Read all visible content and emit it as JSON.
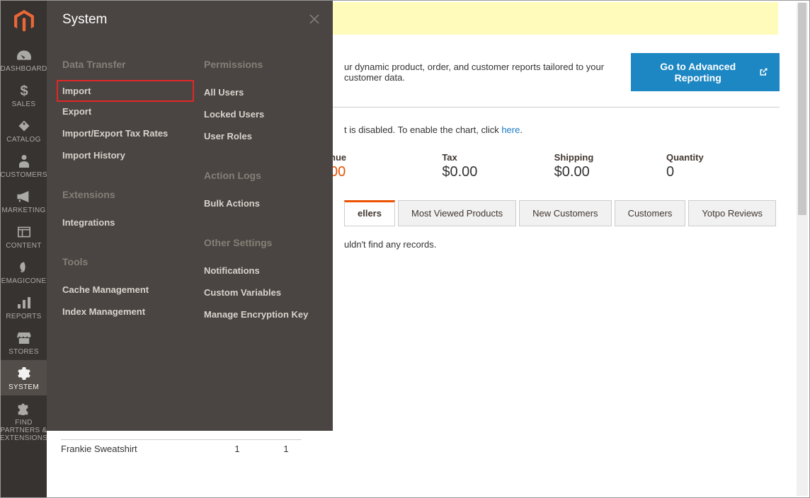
{
  "sidebar": {
    "items": [
      {
        "label": "DASHBOARD"
      },
      {
        "label": "SALES"
      },
      {
        "label": "CATALOG"
      },
      {
        "label": "CUSTOMERS"
      },
      {
        "label": "MARKETING"
      },
      {
        "label": "CONTENT"
      },
      {
        "label": "EMAGICONE"
      },
      {
        "label": "REPORTS"
      },
      {
        "label": "STORES"
      },
      {
        "label": "SYSTEM"
      },
      {
        "label": "FIND PARTNERS & EXTENSIONS"
      }
    ]
  },
  "flyout": {
    "title": "System",
    "groups": {
      "data_transfer": {
        "title": "Data Transfer",
        "import": "Import",
        "export": "Export",
        "tax_rates": "Import/Export Tax Rates",
        "history": "Import History"
      },
      "extensions": {
        "title": "Extensions",
        "integrations": "Integrations"
      },
      "tools": {
        "title": "Tools",
        "cache": "Cache Management",
        "index": "Index Management"
      },
      "permissions": {
        "title": "Permissions",
        "all_users": "All Users",
        "locked_users": "Locked Users",
        "user_roles": "User Roles"
      },
      "action_logs": {
        "title": "Action Logs",
        "bulk": "Bulk Actions"
      },
      "other_settings": {
        "title": "Other Settings",
        "notifications": "Notifications",
        "custom_vars": "Custom Variables",
        "encryption": "Manage Encryption Key"
      }
    }
  },
  "main": {
    "adv_rep_desc": "ur dynamic product, order, and customer reports tailored to your customer data.",
    "adv_rep_btn": "Go to Advanced Reporting",
    "chart_note_pre": "t is disabled. To enable the chart, click ",
    "chart_note_link": "here",
    "stats": {
      "revenue": {
        "label": "nue",
        "value": "00"
      },
      "tax": {
        "label": "Tax",
        "value": "$0.00"
      },
      "shipping": {
        "label": "Shipping",
        "value": "$0.00"
      },
      "quantity": {
        "label": "Quantity",
        "value": "0"
      }
    },
    "tabs": {
      "bestsellers": "ellers",
      "most_viewed": "Most Viewed Products",
      "new_customers": "New Customers",
      "customers": "Customers",
      "yotpo": "Yotpo Reviews"
    },
    "empty_msg": "uldn't find any records."
  },
  "bestseller": {
    "name": "Frankie Sweatshirt",
    "col1": "1",
    "col2": "1"
  }
}
